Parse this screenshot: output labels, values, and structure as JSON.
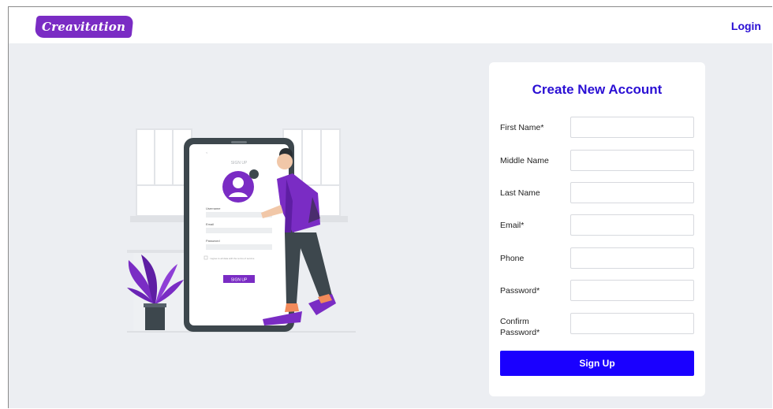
{
  "header": {
    "logo_text": "Creavitation",
    "login_label": "Login"
  },
  "illustration": {
    "phone_title": "SIGN UP",
    "field_username": "Username",
    "field_email": "Email",
    "field_password": "Password",
    "agree_text": "I agree to all data with the terms of service",
    "phone_button": "SIGN UP"
  },
  "form": {
    "title": "Create New Account",
    "fields": [
      {
        "label": "First Name*",
        "value": ""
      },
      {
        "label": "Middle Name",
        "value": ""
      },
      {
        "label": "Last Name",
        "value": ""
      },
      {
        "label": "Email*",
        "value": ""
      },
      {
        "label": "Phone",
        "value": ""
      },
      {
        "label": "Password*",
        "value": ""
      },
      {
        "label": "Confirm Password*",
        "value": ""
      }
    ],
    "submit_label": "Sign Up"
  },
  "colors": {
    "brand_purple": "#7a2cc4",
    "primary_blue": "#1a00ff",
    "link_blue": "#2a0fd4",
    "background": "#eceef2"
  }
}
